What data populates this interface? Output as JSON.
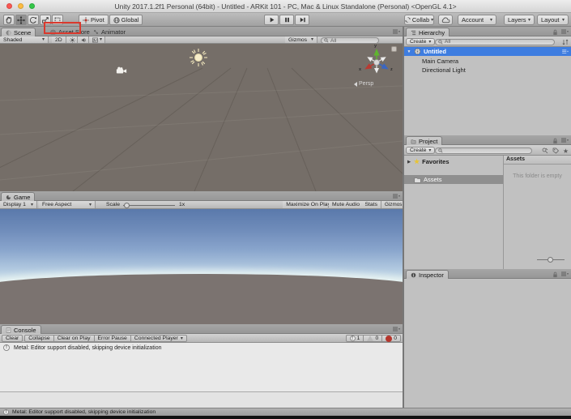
{
  "window": {
    "title": "Unity 2017.1.2f1 Personal (64bit) - Untitled - ARKit 101 - PC, Mac & Linux Standalone (Personal) <OpenGL 4.1>"
  },
  "toolbar": {
    "pivot": "Pivot",
    "global": "Global",
    "collab": "Collab",
    "account": "Account",
    "layers": "Layers",
    "layout": "Layout"
  },
  "scene": {
    "tab": "Scene",
    "tab_asset_store": "Asset Store",
    "tab_animator": "Animator",
    "shading": "Shaded",
    "mode_2d": "2D",
    "gizmos": "Gizmos",
    "search_placeholder": "All",
    "persp": "Persp",
    "axis": {
      "x": "x",
      "y": "y",
      "z": "z"
    }
  },
  "game": {
    "tab": "Game",
    "display": "Display 1",
    "aspect": "Free Aspect",
    "scale_label": "Scale",
    "scale_value": "1x",
    "maximize": "Maximize On Play",
    "mute": "Mute Audio",
    "stats": "Stats",
    "gizmos": "Gizmos"
  },
  "hierarchy": {
    "tab": "Hierarchy",
    "create": "Create",
    "search_placeholder": "All",
    "items": [
      {
        "label": "Untitled",
        "selected": true
      },
      {
        "label": "Main Camera",
        "selected": false
      },
      {
        "label": "Directional Light",
        "selected": false
      }
    ]
  },
  "project": {
    "tab": "Project",
    "create": "Create",
    "favorites": "Favorites",
    "assets_folder": "Assets",
    "assets_header": "Assets",
    "empty": "This folder is empty"
  },
  "inspector": {
    "tab": "Inspector"
  },
  "console": {
    "tab": "Console",
    "clear": "Clear",
    "collapse": "Collapse",
    "clear_on_play": "Clear on Play",
    "error_pause": "Error Pause",
    "connected_player": "Connected Player",
    "info_count": "1",
    "warn_count": "0",
    "error_count": "0",
    "message": "Metal: Editor support disabled, skipping device initialization"
  },
  "status": {
    "message": "Metal: Editor support disabled, skipping device initialization"
  },
  "colors": {
    "selection_blue": "#3e7de0",
    "annotation_red": "#da392d",
    "scene_background": "#756e68",
    "ground": "#7b7370"
  }
}
